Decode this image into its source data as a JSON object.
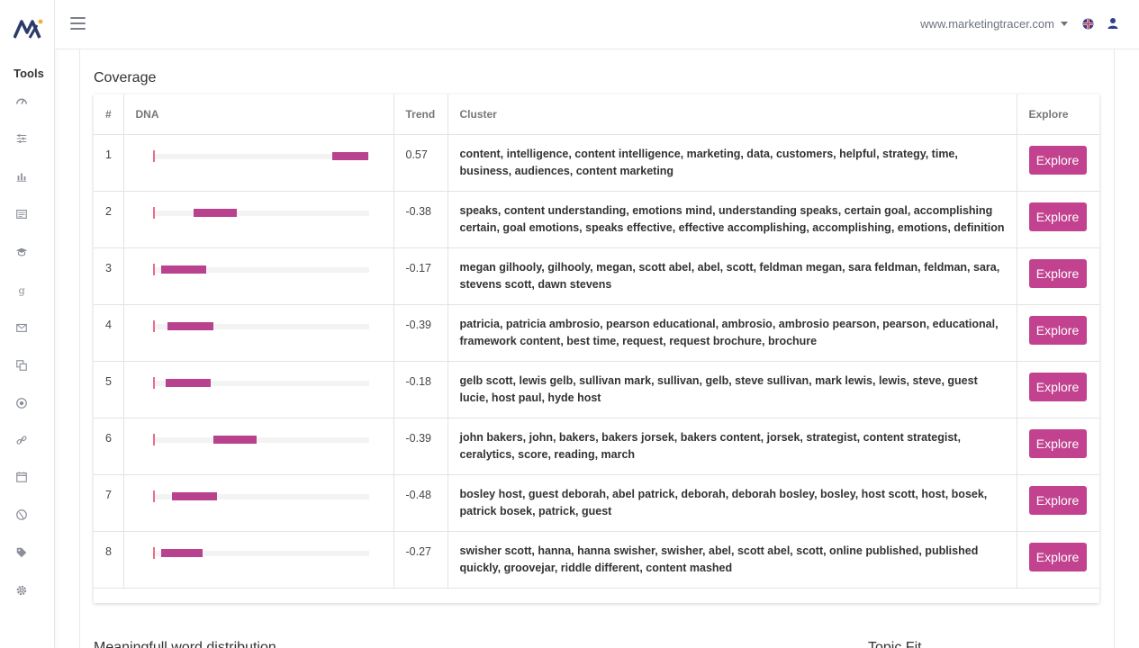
{
  "topbar": {
    "site": "www.marketingtracer.com"
  },
  "sidebar": {
    "title": "Tools",
    "icons": [
      "speedometer-icon",
      "sliders-icon",
      "bar-chart-icon",
      "newspaper-icon",
      "graduation-cap-icon",
      "google-icon",
      "envelope-icon",
      "copy-icon",
      "target-icon",
      "link-icon",
      "calendar-icon",
      "globe-icon",
      "tag-icon",
      "gear-icon"
    ]
  },
  "coverage": {
    "title": "Coverage",
    "columns": [
      "#",
      "DNA",
      "Trend",
      "Cluster",
      "Explore"
    ],
    "explore_label": "Explore",
    "rows": [
      {
        "num": "1",
        "trend": "0.57",
        "dna_start": 0.83,
        "dna_end": 1.0,
        "cluster": "content, intelligence, content intelligence, marketing, data, customers, helpful, strategy, time, business, audiences, content marketing"
      },
      {
        "num": "2",
        "trend": "-0.38",
        "dna_start": 0.19,
        "dna_end": 0.39,
        "cluster": "speaks, content understanding, emotions mind, understanding speaks, certain goal, accomplishing certain, goal emotions, speaks effective, effective accomplishing, accomplishing, emotions, definition"
      },
      {
        "num": "3",
        "trend": "-0.17",
        "dna_start": 0.04,
        "dna_end": 0.25,
        "cluster": "megan gilhooly, gilhooly, megan, scott abel, abel, scott, feldman megan, sara feldman, feldman, sara, stevens scott, dawn stevens"
      },
      {
        "num": "4",
        "trend": "-0.39",
        "dna_start": 0.07,
        "dna_end": 0.28,
        "cluster": "patricia, patricia ambrosio, pearson educational, ambrosio, ambrosio pearson, pearson, educational, framework content, best time, request, request brochure, brochure"
      },
      {
        "num": "5",
        "trend": "-0.18",
        "dna_start": 0.06,
        "dna_end": 0.27,
        "cluster": "gelb scott, lewis gelb, sullivan mark, sullivan, gelb, steve sullivan, mark lewis, lewis, steve, guest lucie, host paul, hyde host"
      },
      {
        "num": "6",
        "trend": "-0.39",
        "dna_start": 0.28,
        "dna_end": 0.48,
        "cluster": "john bakers, john, bakers, bakers jorsek, bakers content, jorsek, strategist, content strategist, ceralytics, score, reading, march"
      },
      {
        "num": "7",
        "trend": "-0.48",
        "dna_start": 0.09,
        "dna_end": 0.3,
        "cluster": "bosley host, guest deborah, abel patrick, deborah, deborah bosley, bosley, host scott, host, bosek, patrick bosek, patrick, guest"
      },
      {
        "num": "8",
        "trend": "-0.27",
        "dna_start": 0.04,
        "dna_end": 0.23,
        "cluster": "swisher scott, hanna, hanna swisher, swisher, abel, scott abel, scott, online published, published quickly, groovejar, riddle different, content mashed"
      }
    ]
  },
  "lower_sections": {
    "left_title": "Meaningfull word distribution",
    "right_title": "Topic Fit"
  }
}
